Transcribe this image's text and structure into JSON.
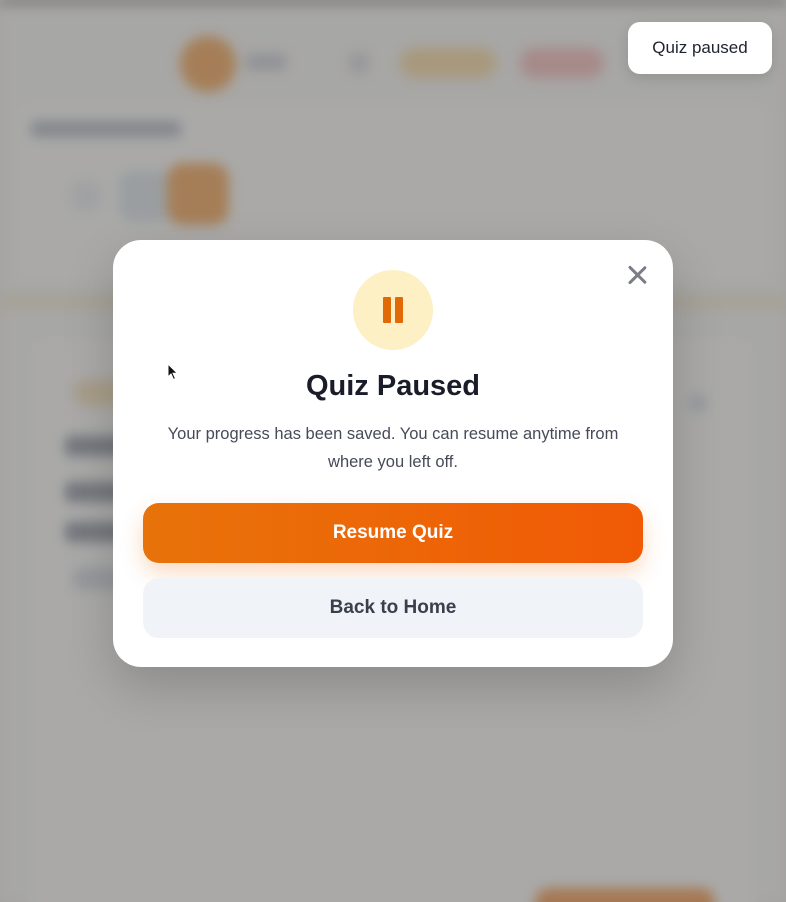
{
  "toast": {
    "text": "Quiz paused"
  },
  "modal": {
    "title": "Quiz Paused",
    "description": "Your progress has been saved. You can resume anytime from where you left off.",
    "resume_label": "Resume Quiz",
    "home_label": "Back to Home",
    "icon": "pause-icon",
    "close_icon": "close-icon"
  },
  "colors": {
    "accent": "#e8730a",
    "accent_end": "#f15a05",
    "pause_bg": "#fdf0c4",
    "secondary_button_bg": "#f0f3f8"
  }
}
